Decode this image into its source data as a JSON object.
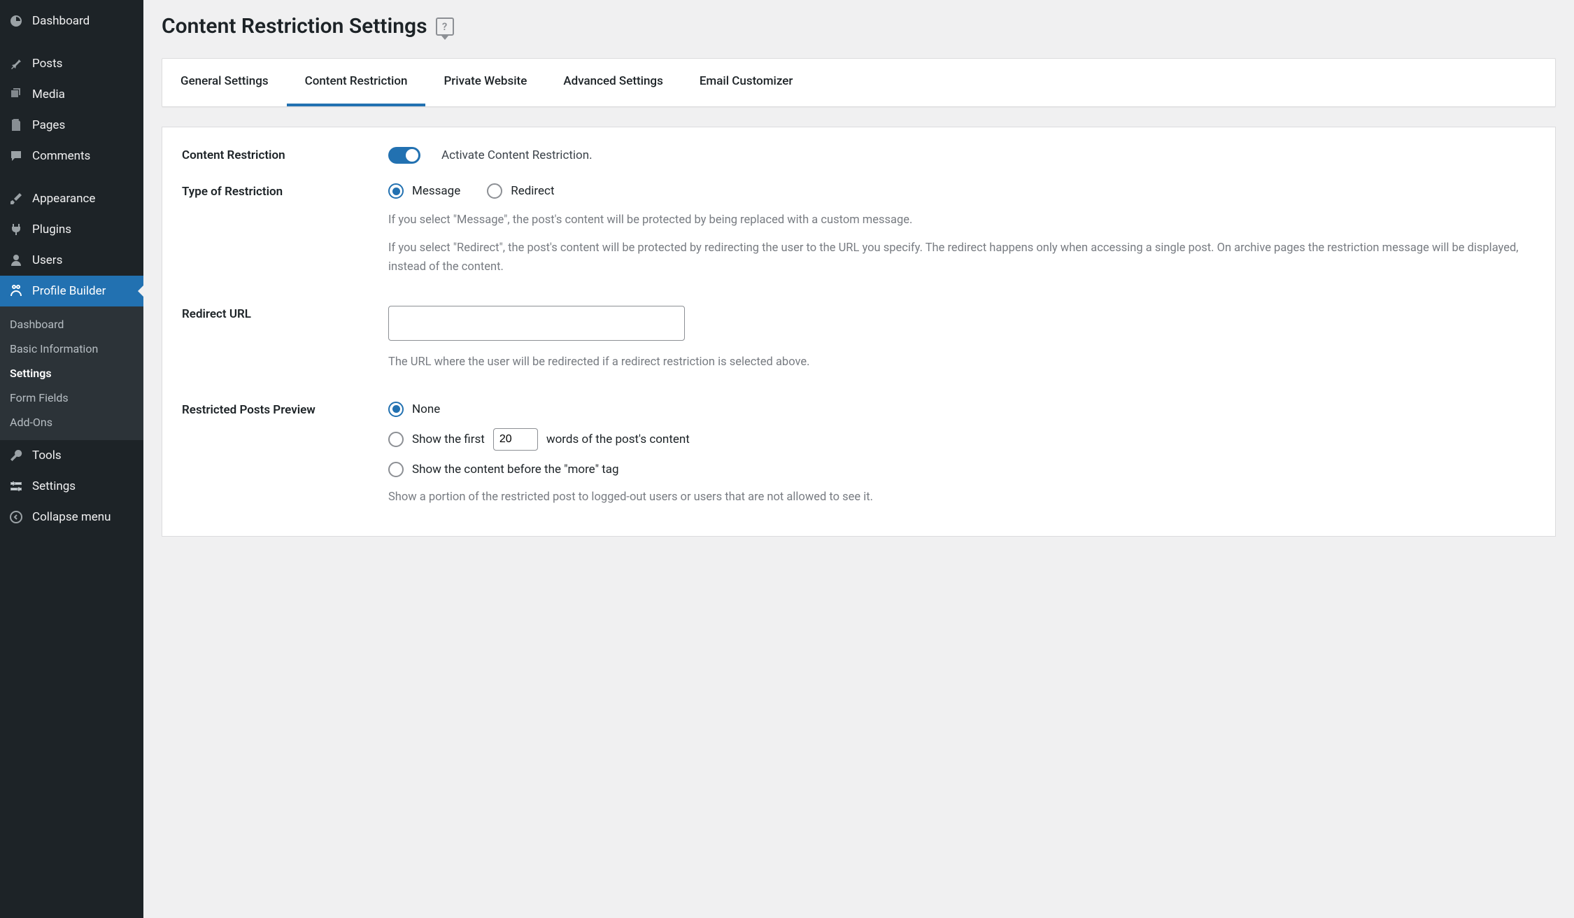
{
  "sidebar": {
    "items": [
      {
        "label": "Dashboard"
      },
      {
        "label": "Posts"
      },
      {
        "label": "Media"
      },
      {
        "label": "Pages"
      },
      {
        "label": "Comments"
      },
      {
        "label": "Appearance"
      },
      {
        "label": "Plugins"
      },
      {
        "label": "Users"
      },
      {
        "label": "Profile Builder"
      },
      {
        "label": "Tools"
      },
      {
        "label": "Settings"
      },
      {
        "label": "Collapse menu"
      }
    ],
    "submenu": [
      {
        "label": "Dashboard"
      },
      {
        "label": "Basic Information"
      },
      {
        "label": "Settings"
      },
      {
        "label": "Form Fields"
      },
      {
        "label": "Add-Ons"
      }
    ]
  },
  "page": {
    "title": "Content Restriction Settings",
    "help": "?"
  },
  "tabs": [
    {
      "label": "General Settings"
    },
    {
      "label": "Content Restriction"
    },
    {
      "label": "Private Website"
    },
    {
      "label": "Advanced Settings"
    },
    {
      "label": "Email Customizer"
    }
  ],
  "form": {
    "content_restriction": {
      "label": "Content Restriction",
      "activate_label": "Activate Content Restriction."
    },
    "type": {
      "label": "Type of Restriction",
      "message": "Message",
      "redirect": "Redirect",
      "desc1": "If you select \"Message\", the post's content will be protected by being replaced with a custom message.",
      "desc2": "If you select \"Redirect\", the post's content will be protected by redirecting the user to the URL you specify. The redirect happens only when accessing a single post. On archive pages the restriction message will be displayed, instead of the content."
    },
    "redirect_url": {
      "label": "Redirect URL",
      "value": "",
      "desc": "The URL where the user will be redirected if a redirect restriction is selected above."
    },
    "preview": {
      "label": "Restricted Posts Preview",
      "none": "None",
      "first_pre": "Show the first ",
      "first_value": "20",
      "first_post": " words of the post's content",
      "more": "Show the content before the \"more\" tag",
      "desc": "Show a portion of the restricted post to logged-out users or users that are not allowed to see it."
    }
  }
}
